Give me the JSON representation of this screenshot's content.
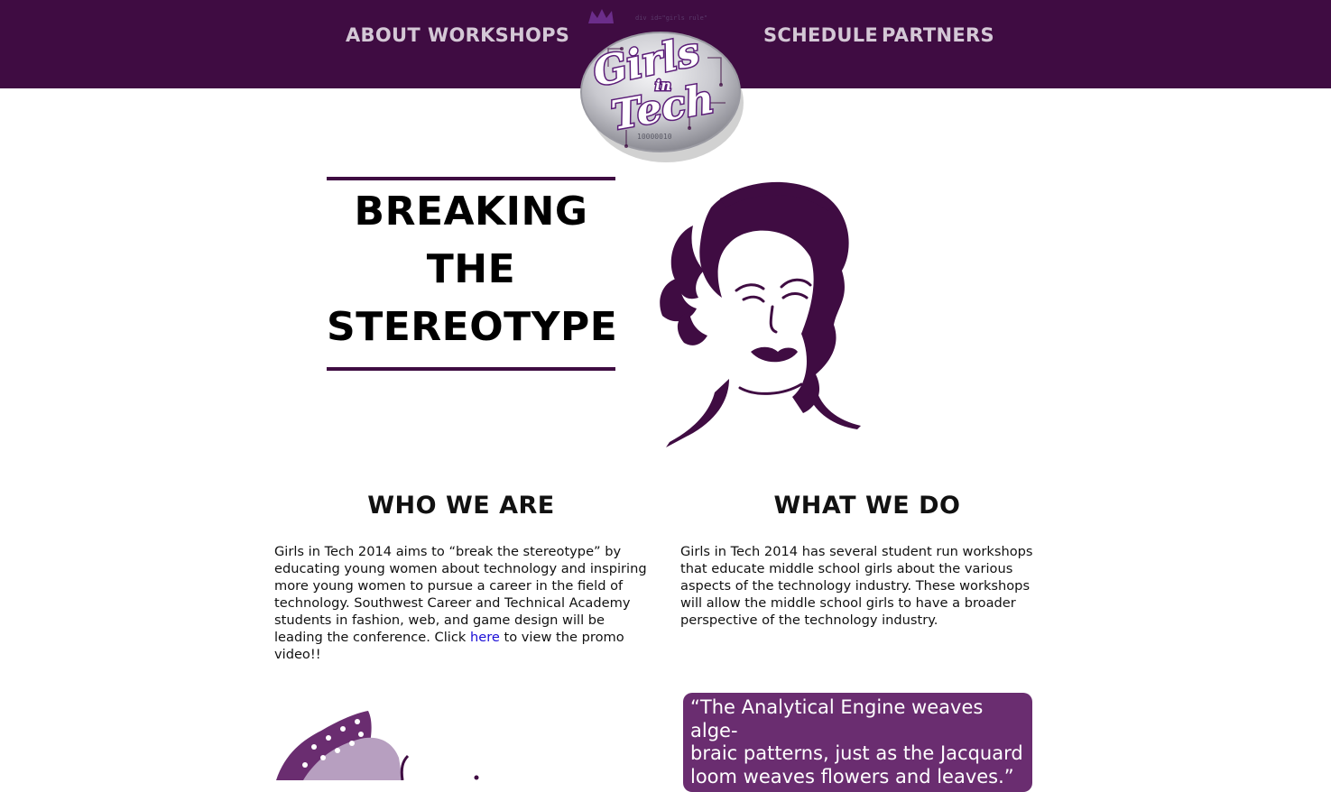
{
  "nav": {
    "about": "ABOUT",
    "workshops": "WORKSHOPS",
    "schedule": "SCHEDULE",
    "partners": "PARTNERS"
  },
  "logo": {
    "word1": "Girls",
    "word2": "in",
    "word3": "Tech",
    "code_snippet": "div id=\"girls rule\"",
    "binary": "10000010"
  },
  "hero": {
    "line1": "BREAKING",
    "line2": "THE",
    "line3": "STEREOTYPE"
  },
  "who": {
    "heading": "WHO WE ARE",
    "body_before": "Girls in Tech 2014 aims to “break the stereotype” by educating young women about technology and inspiring more young women to pursue a career in the field of technology. Southwest Career and Technical Academy students in fashion, web, and game design will be leading the conference. Click ",
    "link": "here",
    "body_after": " to view the promo video!!"
  },
  "what": {
    "heading": "WHAT WE DO",
    "body": "Girls in Tech 2014 has several student run workshops that educate middle school girls about the various aspects of the technology industry. These workshops will allow the middle school girls to have a broader perspective of the technology industry."
  },
  "quote": {
    "line1": "“The Analytical Engine weaves alge-",
    "line2": "braic patterns, just as the Jacquard",
    "line3": "loom weaves flowers and leaves.”"
  },
  "colors": {
    "brand_purple": "#3f0c42",
    "nav_text": "#d4c8d6",
    "quote_bg": "#6a2d70",
    "link_blue": "#1a0dd6"
  },
  "icons": {
    "logo": "girls-in-tech-logo",
    "hero_illustration": "retro-woman-illustration",
    "rosie_illustration": "rosie-riveter-illustration"
  }
}
